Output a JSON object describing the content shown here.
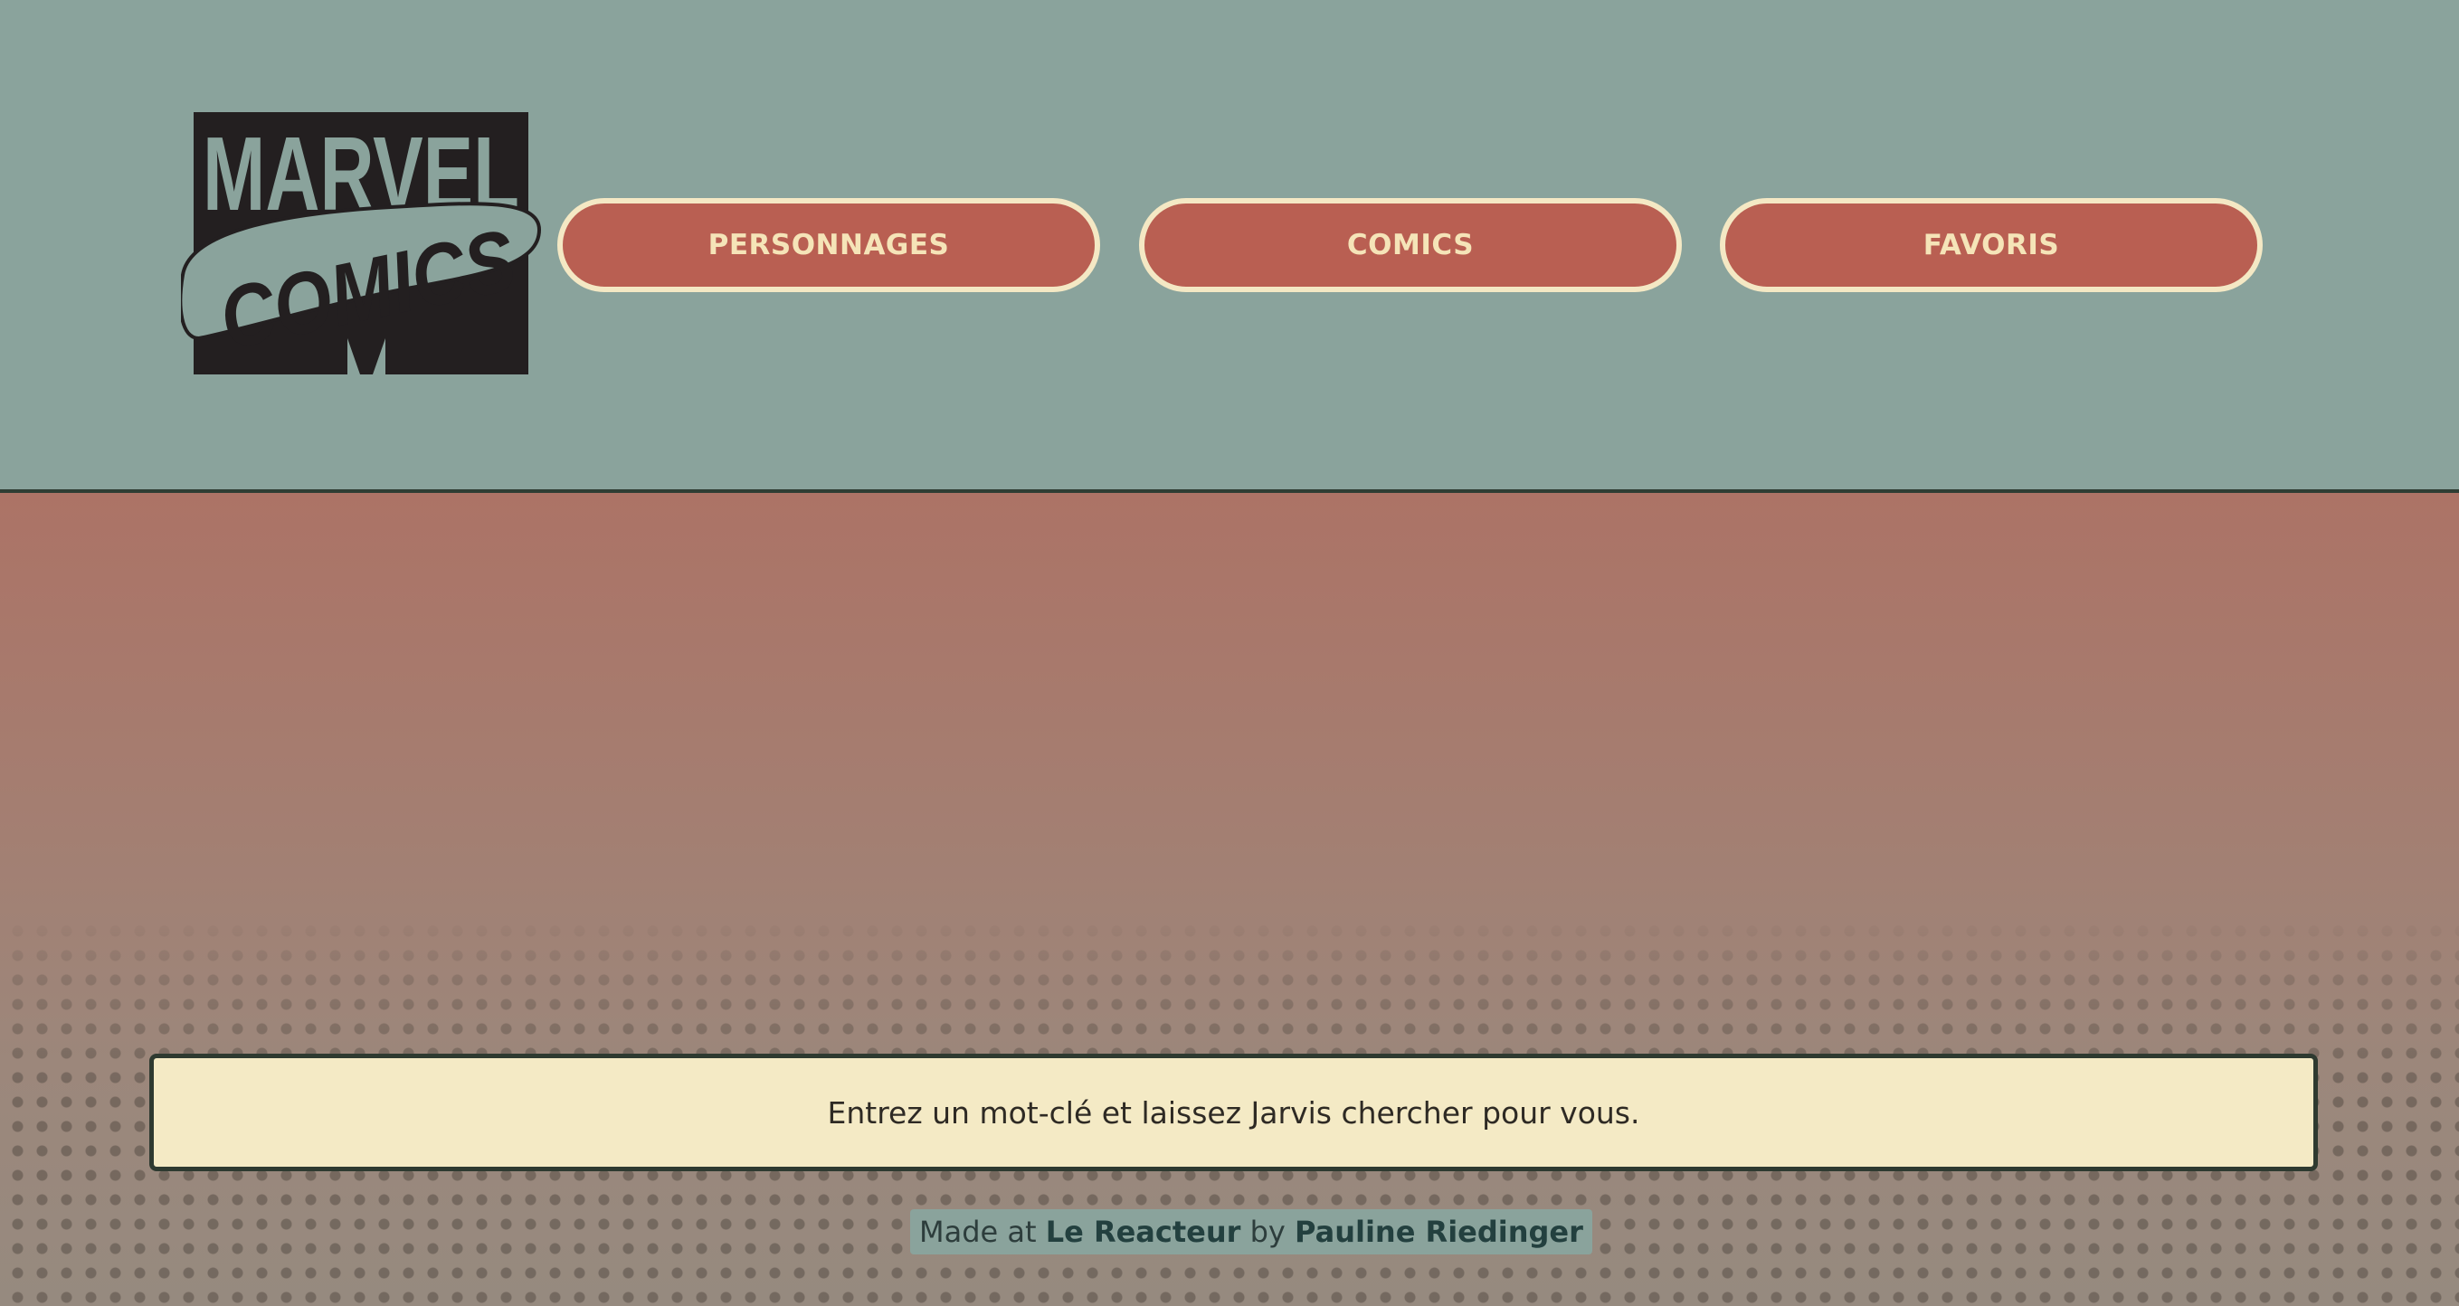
{
  "header": {
    "logo": {
      "line1": "MARVEL",
      "line2": "COMICS",
      "icon": "marvel-comics-logo"
    },
    "nav": [
      {
        "label": "PERSONNAGES"
      },
      {
        "label": "COMICS"
      },
      {
        "label": "FAVORIS"
      }
    ]
  },
  "search": {
    "placeholder": "Entrez un mot-clé et laissez Jarvis chercher pour vous.",
    "value": ""
  },
  "footer": {
    "prefix": "Made at",
    "school": "Le Reacteur",
    "by": "by",
    "author": "Pauline Riedinger"
  },
  "colors": {
    "header_bg": "#8aa39c",
    "button_bg": "#b95f52",
    "button_border": "#f4e8c4",
    "button_text": "#f5e4b8",
    "search_bg": "#f4eac5",
    "border_dark": "#2e3a30"
  }
}
